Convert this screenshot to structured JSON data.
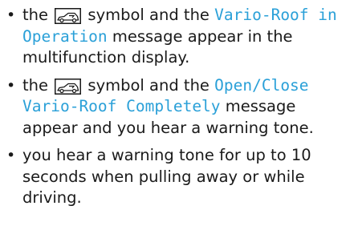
{
  "accent_color": "#2aa0d8",
  "items": [
    {
      "text_a": "the",
      "icon": "convertible-roof-icon",
      "text_b": "symbol and the",
      "highlight": "Vario-Roof in Operation",
      "text_c": "message appear in the multifunction display."
    },
    {
      "text_a": "the",
      "icon": "convertible-roof-icon",
      "text_b": "symbol and the",
      "highlight": "Open/Close Vario-Roof Completely",
      "text_c": "message appear and you hear a warning tone."
    },
    {
      "text_a": "you hear a warning tone for up to 10 seconds when pulling away or while driving."
    }
  ]
}
